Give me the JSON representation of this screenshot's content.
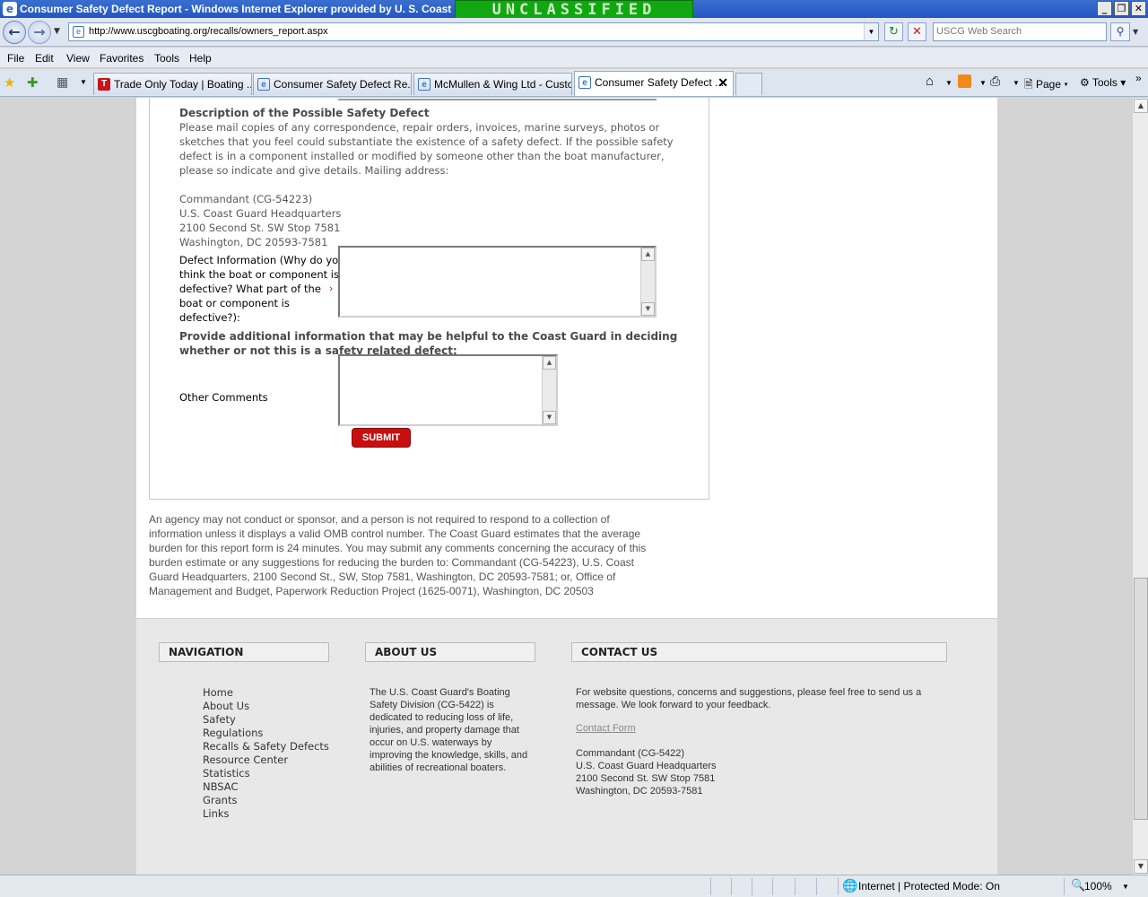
{
  "window": {
    "title": "Consumer Safety Defect Report - Windows Internet Explorer provided by U. S. Coast Gu",
    "banner": "UNCLASSIFIED",
    "controls": [
      "_",
      "❐",
      "✕"
    ]
  },
  "address": {
    "url": "http://www.uscgboating.org/recalls/owners_report.aspx",
    "search_placeholder": "USCG Web Search"
  },
  "menu": [
    "File",
    "Edit",
    "View",
    "Favorites",
    "Tools",
    "Help"
  ],
  "tabs": [
    {
      "label": "Trade Only Today | Boating ...",
      "active": false
    },
    {
      "label": "Consumer Safety Defect Re...",
      "active": false
    },
    {
      "label": "McMullen & Wing Ltd - Custo...",
      "active": false
    },
    {
      "label": "Consumer Safety Defect ...",
      "active": true
    }
  ],
  "commandbar": {
    "page": "Page",
    "tools": "Tools"
  },
  "form": {
    "description_heading": "Description of the Possible Safety Defect",
    "description_lines": [
      "Please mail copies of any correspondence, repair orders, invoices, marine surveys, photos or",
      "sketches that you feel could substantiate the existence of a safety defect. If the possible safety",
      "defect is in a component installed or modified by someone other than the boat manufacturer,",
      "please so indicate and give details. Mailing address:"
    ],
    "mailing_address": [
      "Commandant (CG-54223)",
      "U.S. Coast Guard Headquarters",
      "2100 Second St. SW Stop 7581",
      "Washington, DC 20593-7581"
    ],
    "defect_info_label_lines": [
      "Defect Information (Why do you",
      "think the boat or component is",
      "defective? What part of the",
      "boat or component is",
      "defective?):"
    ],
    "required_marker": "›",
    "additional_heading_lines": [
      "Provide additional information that may be helpful to the Coast Guard in deciding",
      "whether or not this is a safety related defect:"
    ],
    "other_comments_label": "Other Comments",
    "submit_label": "SUBMIT"
  },
  "omb_lines": [
    "An agency may not conduct or sponsor, and a person is not required to respond to a collection of",
    "information unless it displays a valid OMB control number.  The Coast Guard estimates that the average",
    "burden for this report form is 24 minutes.  You may submit any comments concerning the accuracy of this",
    "burden estimate or any suggestions for reducing the burden to:  Commandant (CG-54223), U.S. Coast",
    "Guard Headquarters, 2100 Second St., SW, Stop 7581, Washington, DC  20593-7581; or, Office of",
    "Management and Budget, Paperwork Reduction Project (1625-0071), Washington, DC  20503"
  ],
  "footer": {
    "navigation_heading": "NAVIGATION",
    "about_heading": "ABOUT US",
    "contact_heading": "CONTACT US",
    "nav_links": [
      "Home",
      "About Us",
      "Safety",
      "Regulations",
      "Recalls & Safety Defects",
      "Resource Center",
      "Statistics",
      "NBSAC",
      "Grants",
      "Links"
    ],
    "about_lines": [
      "The U.S. Coast Guard's Boating",
      "Safety Division (CG-5422) is",
      "dedicated to reducing loss of life,",
      "injuries, and property damage that",
      "occur on U.S. waterways by",
      "improving the knowledge, skills, and",
      "abilities of recreational boaters."
    ],
    "contact_lines": [
      "For website questions, concerns and suggestions, please feel free to send us a",
      "message. We look forward to your feedback."
    ],
    "contact_form_link": "Contact Form",
    "contact_address": [
      "Commandant (CG-5422)",
      "U.S. Coast Guard Headquarters",
      "2100 Second St. SW  Stop 7581",
      "Washington, DC  20593-7581"
    ]
  },
  "status": {
    "zone": "Internet | Protected Mode: On",
    "zoom": "100%"
  }
}
